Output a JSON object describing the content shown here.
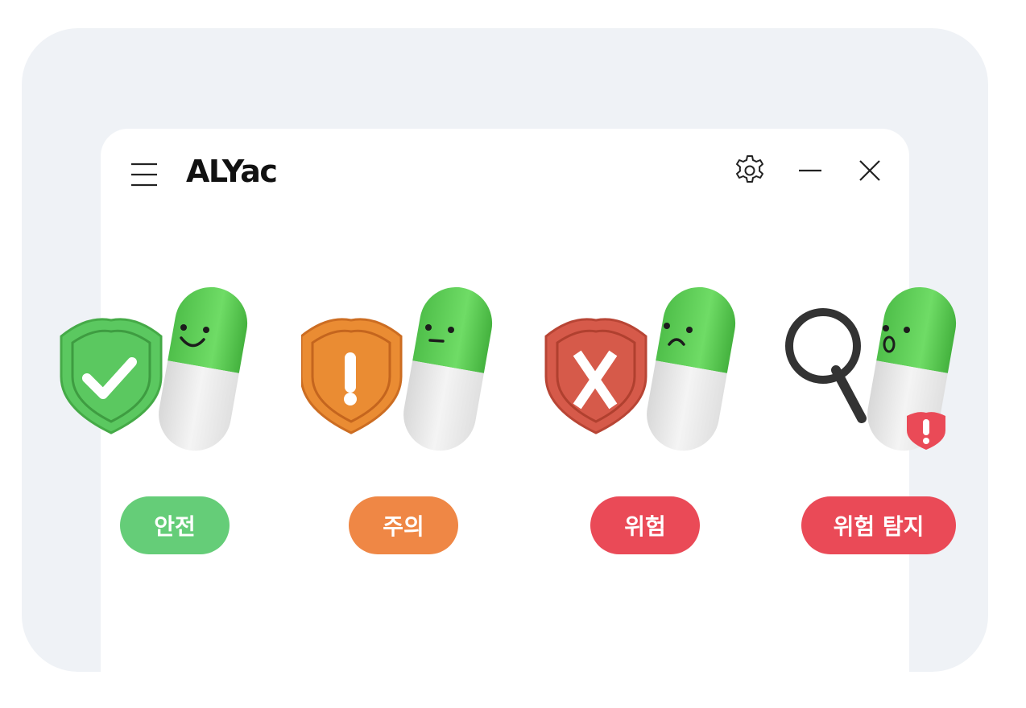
{
  "app": {
    "title": "ALYac"
  },
  "header": {
    "menu_icon": "hamburger-menu-icon",
    "settings_icon": "gear-icon",
    "minimize_icon": "minimize-icon",
    "close_icon": "close-icon"
  },
  "statuses": [
    {
      "label": "안전",
      "color": "#65cd78",
      "badge_icon": "check-shield-icon",
      "face": "smile"
    },
    {
      "label": "주의",
      "color": "#ef8745",
      "badge_icon": "exclamation-shield-icon",
      "face": "neutral"
    },
    {
      "label": "위험",
      "color": "#ea4a57",
      "badge_icon": "x-shield-icon",
      "face": "sad"
    },
    {
      "label": "위험 탐지",
      "color": "#ea4a57",
      "badge_icon": "magnifier-icon",
      "face": "surprised"
    }
  ],
  "colors": {
    "background_card": "#eff2f6",
    "window": "#ffffff",
    "pill_green": "#5cc85a",
    "pill_white": "#eeeeee"
  }
}
